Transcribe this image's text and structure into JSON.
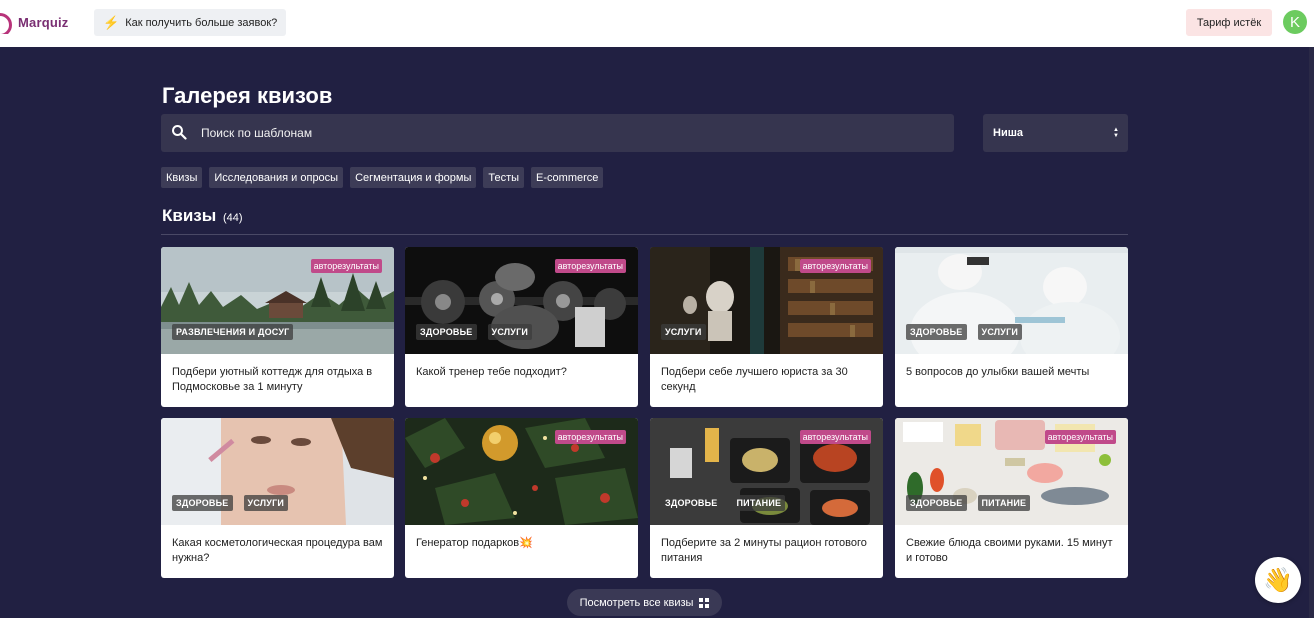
{
  "header": {
    "logo_text": "Marquiz",
    "help_button": "Как получить больше заявок?",
    "tariff_button": "Тариф истёк",
    "avatar_letter": "K"
  },
  "gallery": {
    "title": "Галерея квизов",
    "search_placeholder": "Поиск по шаблонам",
    "niche_select": "Ниша",
    "filters": [
      "Квизы",
      "Исследования и опросы",
      "Сегментация и формы",
      "Тесты",
      "E-commerce"
    ],
    "section_title": "Квизы",
    "section_count": "(44)"
  },
  "cards": [
    {
      "title": "Подбери уютный коттедж для отдыха в Подмосковье за 1 минуту",
      "badge": "авторезультаты",
      "tags": [
        "РАЗВЛЕЧЕНИЯ И ДОСУГ"
      ]
    },
    {
      "title": "Какой тренер тебе подходит?",
      "badge": "авторезультаты",
      "tags": [
        "ЗДОРОВЬЕ",
        "УСЛУГИ"
      ]
    },
    {
      "title": "Подбери себе лучшего юриста за 30 секунд",
      "badge": "авторезультаты",
      "tags": [
        "УСЛУГИ"
      ]
    },
    {
      "title": "5 вопросов до улыбки вашей мечты",
      "badge": "",
      "tags": [
        "ЗДОРОВЬЕ",
        "УСЛУГИ"
      ]
    },
    {
      "title": "Какая косметологическая процедура вам нужна?",
      "badge": "",
      "tags": [
        "ЗДОРОВЬЕ",
        "УСЛУГИ"
      ]
    },
    {
      "title": "Генератор подарков💥",
      "badge": "авторезультаты",
      "tags": []
    },
    {
      "title": "Подберите за 2 минуты рацион готового питания",
      "badge": "авторезультаты",
      "tags": [
        "ЗДОРОВЬЕ",
        "ПИТАНИЕ"
      ]
    },
    {
      "title": "Свежие блюда своими руками. 15 минут и готово",
      "badge": "авторезультаты",
      "tags": [
        "ЗДОРОВЬЕ",
        "ПИТАНИЕ"
      ]
    }
  ],
  "footer": {
    "view_all": "Посмотреть все квизы"
  },
  "colors": {
    "background": "#212042",
    "badge": "#c04a8a",
    "brand": "#b8337a"
  }
}
